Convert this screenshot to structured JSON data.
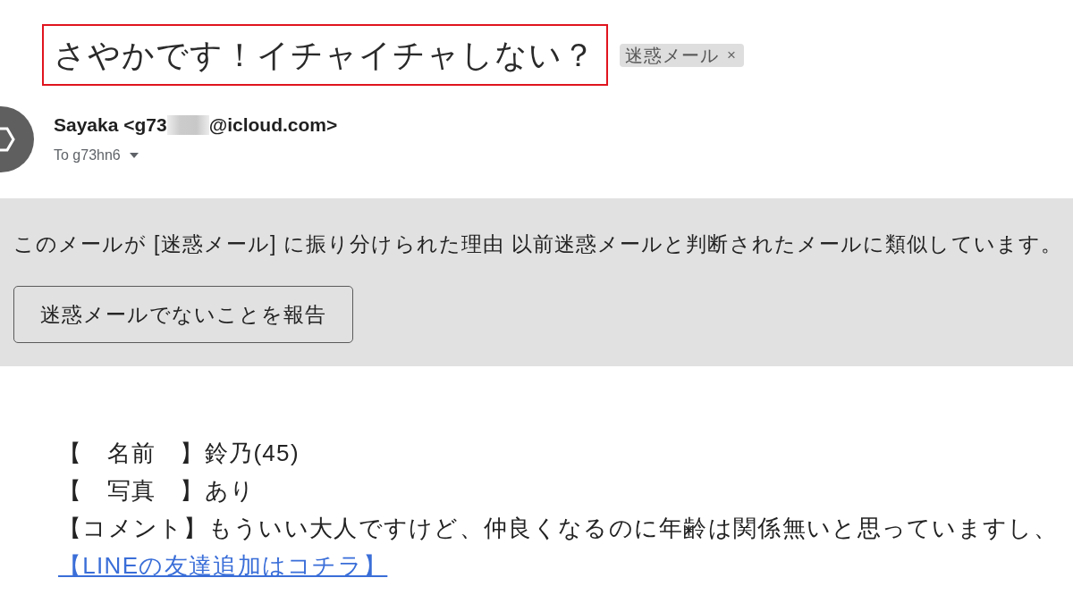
{
  "subject": {
    "text": "さやかです！イチャイチャしない？",
    "highlighted": true
  },
  "label_chip": {
    "label": "迷惑メール",
    "remove": "×"
  },
  "sender": {
    "name_start": "Sayaka <g73",
    "redacted": true,
    "name_end": "@icloud.com>"
  },
  "recipient": {
    "text": "To g73hn6"
  },
  "spam_banner": {
    "reason": "このメールが [迷惑メール] に振り分けられた理由 以前迷惑メールと判断されたメールに類似しています。",
    "button": "迷惑メールでないことを報告"
  },
  "body": {
    "lines": [
      "【　名前　】鈴乃(45)",
      "【　写真　】あり",
      "【コメント】もういい大人ですけど、仲良くなるのに年齢は関係無いと思っていますし、"
    ],
    "link": "【LINEの友達追加はコチラ】"
  }
}
